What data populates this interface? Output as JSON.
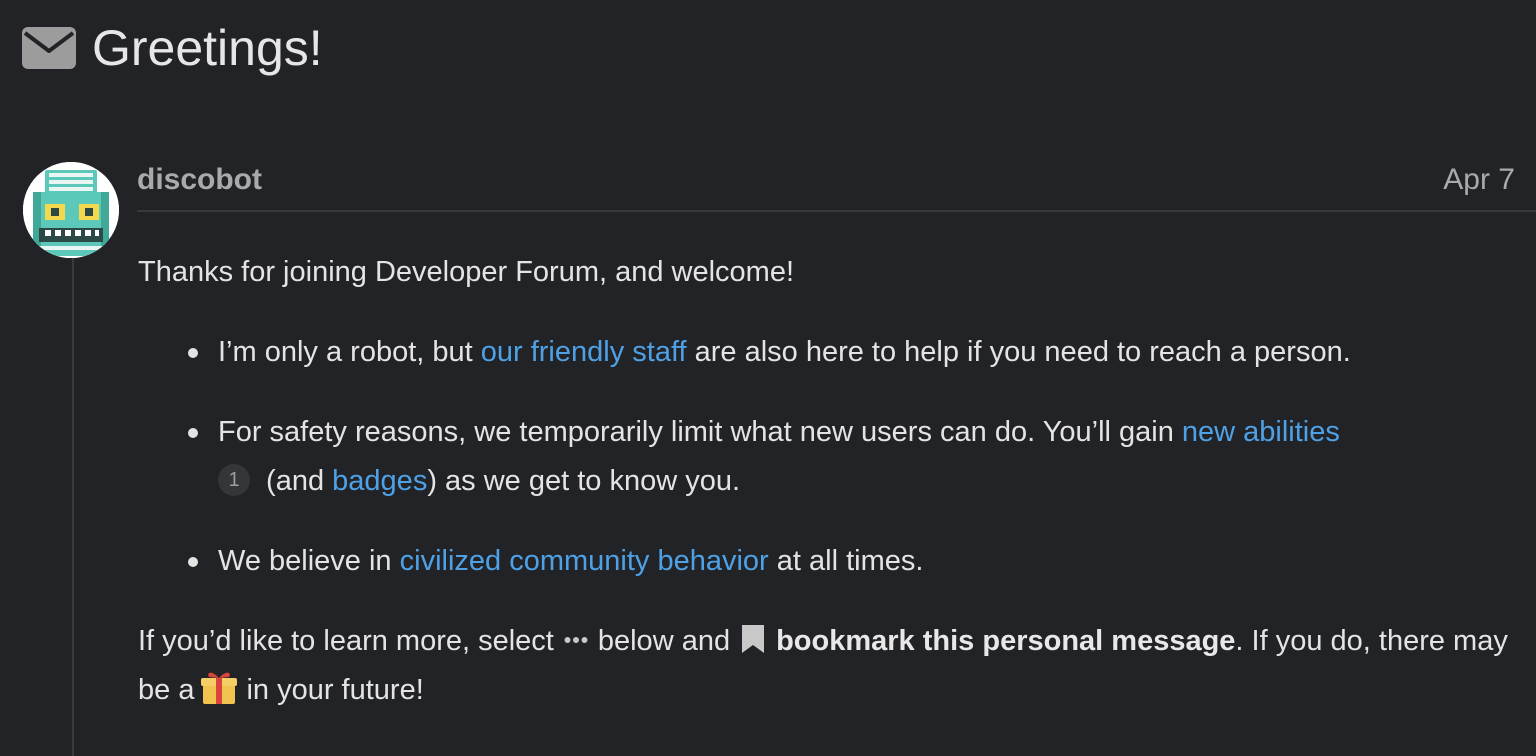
{
  "topic": {
    "title": "Greetings!",
    "icon": "envelope-icon"
  },
  "post": {
    "username": "discobot",
    "date": "Apr 7",
    "intro": "Thanks for joining Developer Forum, and welcome!",
    "bullets": [
      {
        "text_before": "I’m only a robot, but ",
        "link": "our friendly staff",
        "text_after": " are also here to help if you need to reach a person."
      },
      {
        "text_before": "For safety reasons, we temporarily limit what new users can do. You’ll gain ",
        "link": "new abilities",
        "footnote": "1",
        "text_middle": " (and ",
        "link2": "badges",
        "text_after": ") as we get to know you."
      },
      {
        "text_before": "We believe in ",
        "link": "civilized community behavior",
        "text_after": " at all times."
      }
    ],
    "outro": {
      "part1": "If you’d like to learn more, select",
      "part2": "below and",
      "bold": "bookmark this personal message",
      "part3": ". If you do, there may be a",
      "part4": "in your future!"
    }
  },
  "colors": {
    "background": "#222326",
    "link": "#4fa1e6",
    "text": "#e4e4e4",
    "muted": "#a8aaad"
  }
}
